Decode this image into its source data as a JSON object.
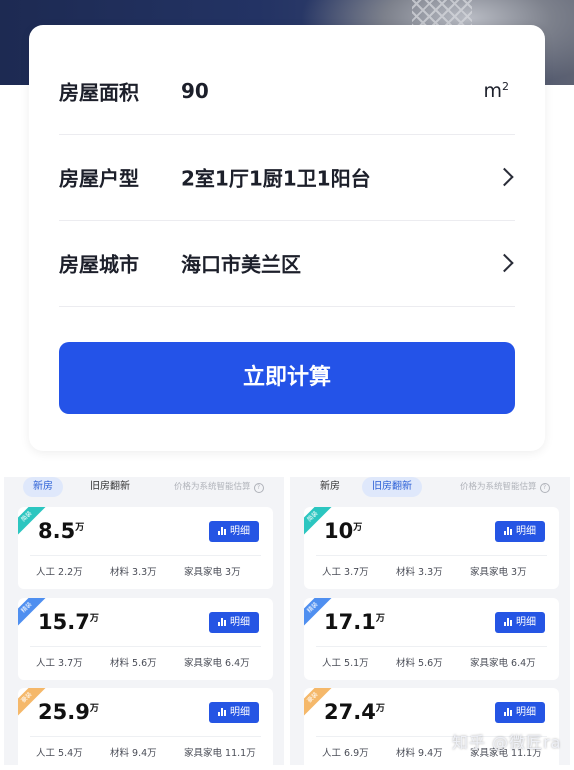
{
  "form": {
    "area": {
      "label": "房屋面积",
      "value": "90",
      "unit": "m",
      "unit_sup": "2"
    },
    "layout": {
      "label": "房屋户型",
      "value": "2室1厅1厨1卫1阳台"
    },
    "city": {
      "label": "房屋城市",
      "value": "海口市美兰区"
    },
    "calc_button": "立即计算"
  },
  "left_panel": {
    "tabs": [
      "新房",
      "旧房翻新"
    ],
    "active_tab": 0,
    "note": "价格为系统智能估算",
    "cards": [
      {
        "badge": "简装",
        "badge_color": "#2cc6c0",
        "price": "8.5",
        "unit": "万",
        "detail": "明细",
        "labor_label": "人工",
        "labor": "2.2万",
        "material_label": "材料",
        "material": "3.3万",
        "furniture_label": "家具家电",
        "furniture": "3万"
      },
      {
        "badge": "精装",
        "badge_color": "#4f8ff0",
        "price": "15.7",
        "unit": "万",
        "detail": "明细",
        "labor_label": "人工",
        "labor": "3.7万",
        "material_label": "材料",
        "material": "5.6万",
        "furniture_label": "家具家电",
        "furniture": "6.4万"
      },
      {
        "badge": "豪装",
        "badge_color": "#f5b86a",
        "price": "25.9",
        "unit": "万",
        "detail": "明细",
        "labor_label": "人工",
        "labor": "5.4万",
        "material_label": "材料",
        "material": "9.4万",
        "furniture_label": "家具家电",
        "furniture": "11.1万"
      }
    ]
  },
  "right_panel": {
    "tabs": [
      "新房",
      "旧房翻新"
    ],
    "active_tab": 1,
    "note": "价格为系统智能估算",
    "cards": [
      {
        "badge": "简装",
        "badge_color": "#2cc6c0",
        "price": "10",
        "unit": "万",
        "detail": "明细",
        "labor_label": "人工",
        "labor": "3.7万",
        "material_label": "材料",
        "material": "3.3万",
        "furniture_label": "家具家电",
        "furniture": "3万"
      },
      {
        "badge": "精装",
        "badge_color": "#4f8ff0",
        "price": "17.1",
        "unit": "万",
        "detail": "明细",
        "labor_label": "人工",
        "labor": "5.1万",
        "material_label": "材料",
        "material": "5.6万",
        "furniture_label": "家具家电",
        "furniture": "6.4万"
      },
      {
        "badge": "豪装",
        "badge_color": "#f5b86a",
        "price": "27.4",
        "unit": "万",
        "detail": "明细",
        "labor_label": "人工",
        "labor": "6.9万",
        "material_label": "材料",
        "material": "9.4万",
        "furniture_label": "家具家电",
        "furniture": "11.1万"
      }
    ]
  },
  "watermark": "知乎 @微匠ra"
}
